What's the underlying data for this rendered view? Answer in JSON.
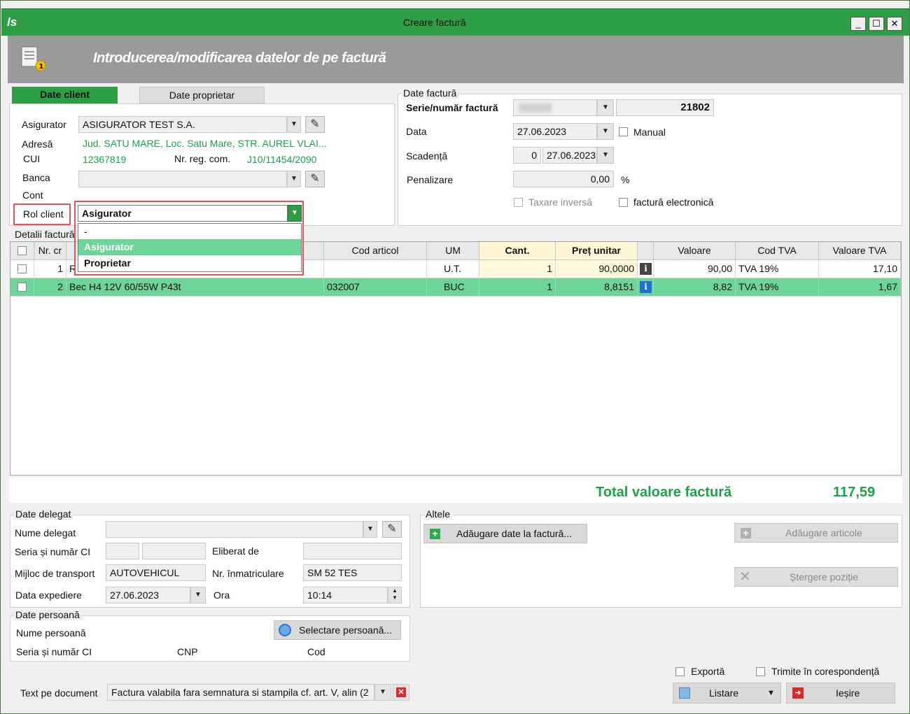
{
  "window": {
    "title": "Creare factură",
    "app_icon": "app-logo-icon",
    "banner_title": "Introducerea/modificarea datelor de pe factură",
    "controls": {
      "minimize": "_",
      "maximize": "☐",
      "close": "✕"
    }
  },
  "tabs": [
    {
      "label": "Date client",
      "active": true
    },
    {
      "label": "Date proprietar",
      "active": false
    }
  ],
  "client": {
    "asigurator_label": "Asigurator",
    "asigurator_value": "ASIGURATOR TEST S.A.",
    "adresa_label": "Adresă",
    "adresa_value": "Jud. SATU MARE, Loc. Satu Mare, STR. AUREL VLAI...",
    "cui_label": "CUI",
    "cui_value": "12367819",
    "nrreg_label": "Nr. reg. com.",
    "nrreg_value": "J10/11454/2090",
    "banca_label": "Banca",
    "banca_value": "",
    "cont_label": "Cont",
    "rol_label": "Rol client",
    "rol_value": "Asigurator",
    "rol_options": [
      "-",
      "Asigurator",
      "Proprietar"
    ],
    "rol_selected_index": 1
  },
  "invoice": {
    "group_title": "Date factură",
    "serie_label": "Serie/număr factură",
    "serie_value": "",
    "numar_value": "21802",
    "data_label": "Data",
    "data_value": "27.06.2023",
    "manual_label": "Manual",
    "scadenta_label": "Scadență",
    "scadenta_days": "0",
    "scadenta_date": "27.06.2023",
    "penalizare_label": "Penalizare",
    "penalizare_value": "0,00",
    "penalizare_unit": "%",
    "taxare_label": "Taxare inversă",
    "efactura_label": "factură electronică"
  },
  "details": {
    "group_title": "Detalii factură",
    "columns": [
      "Nr. cr",
      "Cod articol",
      "UM",
      "Cant.",
      "Preț unitar",
      "Valoare",
      "Cod TVA",
      "Valoare TVA"
    ],
    "rows": [
      {
        "nr": "1",
        "denumire": "R",
        "cod": "",
        "um": "U.T.",
        "cant": "1",
        "pret": "90,0000",
        "valoare": "90,00",
        "cod_tva": "TVA 19%",
        "val_tva": "17,10"
      },
      {
        "nr": "2",
        "denumire": "Bec H4 12V 60/55W P43t",
        "cod": "032007",
        "um": "BUC",
        "cant": "1",
        "pret": "8,8151",
        "valoare": "8,82",
        "cod_tva": "TVA 19%",
        "val_tva": "1,67"
      }
    ],
    "total_label": "Total valoare factură",
    "total_value": "117,59"
  },
  "delegate": {
    "group_title": "Date delegat",
    "nume_label": "Nume delegat",
    "nume_value": "",
    "seria_label": "Seria și număr CI",
    "eliberat_label": "Eliberat de",
    "mijloc_label": "Mijloc de transport",
    "mijloc_value": "AUTOVEHICUL",
    "nrinm_label": "Nr. înmatriculare",
    "nrinm_value": "SM 52 TES",
    "dataexp_label": "Data expediere",
    "dataexp_value": "27.06.2023",
    "ora_label": "Ora",
    "ora_value": "10:14"
  },
  "person": {
    "group_title": "Date persoană",
    "nume_label": "Nume persoană",
    "select_button": "Selectare persoană...",
    "seria_label": "Seria și număr CI",
    "cnp_label": "CNP",
    "cod_label": "Cod"
  },
  "altele": {
    "group_title": "Altele",
    "adaugare_date": "Adăugare date la factură...",
    "adaugare_articole": "Adăugare articole",
    "stergere_pozitie": "Ștergere poziție"
  },
  "footer": {
    "text_label": "Text pe document",
    "text_value": "Factura valabila fara semnatura si stampila cf. art. V, alin (2",
    "exporta_label": "Exportă",
    "trimite_label": "Trimite în corespondență",
    "listare_button": "Listare",
    "iesire_button": "Ieșire"
  },
  "colors": {
    "title_green": "#2e9e45",
    "accent_green": "#1aa34a",
    "selected_row": "#6dd49a",
    "highlight_box": "#e05555"
  }
}
